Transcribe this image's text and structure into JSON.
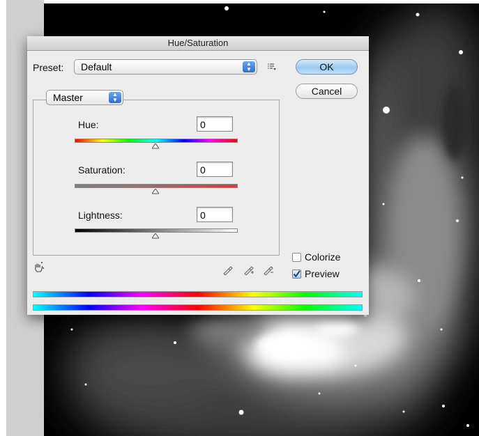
{
  "dialog": {
    "title": "Hue/Saturation",
    "preset_label": "Preset:",
    "preset_value": "Default",
    "ok_label": "OK",
    "cancel_label": "Cancel",
    "channel_value": "Master",
    "hue_label": "Hue:",
    "hue_value": "0",
    "saturation_label": "Saturation:",
    "saturation_value": "0",
    "lightness_label": "Lightness:",
    "lightness_value": "0",
    "colorize_label": "Colorize",
    "colorize_checked": false,
    "preview_label": "Preview",
    "preview_checked": true
  },
  "icons": {
    "preset_options": "preset-options-icon",
    "targeted_adjustment": "hand-adjust-icon",
    "eyedropper": "eyedropper-icon",
    "eyedropper_add": "eyedropper-plus-icon",
    "eyedropper_subtract": "eyedropper-minus-icon"
  },
  "colors": {
    "ok_button": "#9cc9f0",
    "dialog_bg": "#ececec",
    "popup_stepper": "#2f6fd0"
  }
}
